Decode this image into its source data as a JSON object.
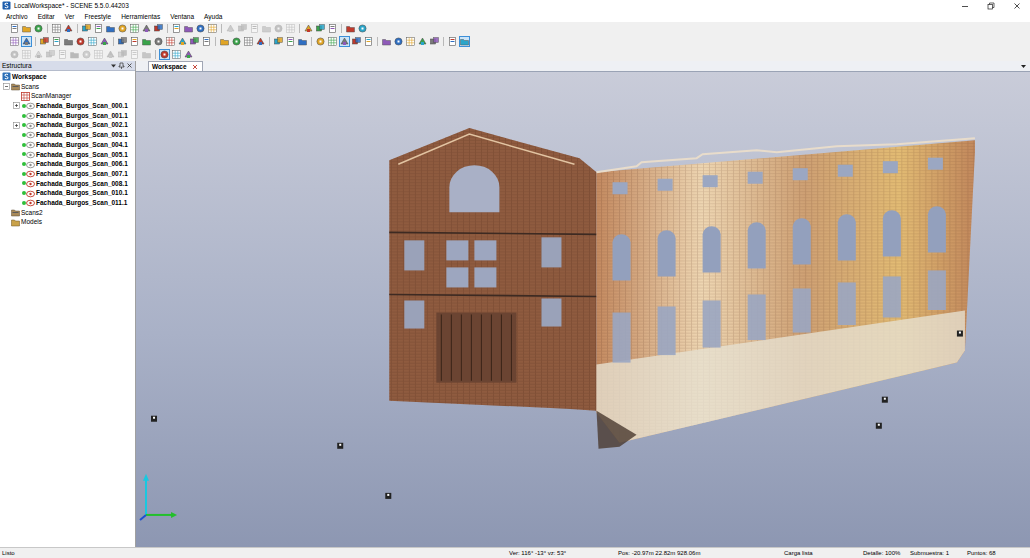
{
  "window": {
    "title": "LocalWorkspace* - SCENE 5.5.0.44203"
  },
  "menu": [
    {
      "label": "Archivo"
    },
    {
      "label": "Editar"
    },
    {
      "label": "Ver"
    },
    {
      "label": "Freestyle"
    },
    {
      "label": "Herramientas"
    },
    {
      "label": "Ventana"
    },
    {
      "label": "Ayuda"
    }
  ],
  "toolbars": [
    {
      "groups": [
        [
          {
            "selected": false,
            "disabled": false
          },
          {
            "selected": false,
            "disabled": false
          },
          {
            "selected": false,
            "disabled": false
          }
        ],
        [
          {
            "selected": false,
            "disabled": false
          },
          {
            "selected": false,
            "disabled": false
          }
        ],
        [
          {
            "selected": false,
            "disabled": false
          },
          {
            "selected": false,
            "disabled": false
          },
          {
            "selected": false,
            "disabled": false
          },
          {
            "selected": false,
            "disabled": false
          },
          {
            "selected": false,
            "disabled": false
          },
          {
            "selected": false,
            "disabled": false
          },
          {
            "selected": false,
            "disabled": false
          }
        ],
        [
          {
            "selected": false,
            "disabled": false
          },
          {
            "selected": false,
            "disabled": false
          },
          {
            "selected": false,
            "disabled": false
          },
          {
            "selected": false,
            "disabled": false
          }
        ],
        [
          {
            "selected": false,
            "disabled": true
          },
          {
            "selected": false,
            "disabled": true
          },
          {
            "selected": false,
            "disabled": true
          },
          {
            "selected": false,
            "disabled": true
          },
          {
            "selected": false,
            "disabled": true
          },
          {
            "selected": false,
            "disabled": true
          }
        ],
        [
          {
            "selected": false,
            "disabled": false
          },
          {
            "selected": false,
            "disabled": false
          },
          {
            "selected": false,
            "disabled": false
          }
        ],
        [
          {
            "selected": false,
            "disabled": false
          },
          {
            "selected": false,
            "disabled": false
          }
        ]
      ]
    },
    {
      "groups": [
        [
          {
            "selected": false,
            "disabled": false
          },
          {
            "selected": true,
            "disabled": false
          }
        ],
        [
          {
            "selected": false,
            "disabled": false
          },
          {
            "selected": false,
            "disabled": false
          },
          {
            "selected": false,
            "disabled": false
          },
          {
            "selected": false,
            "disabled": false
          },
          {
            "selected": false,
            "disabled": false
          },
          {
            "selected": false,
            "disabled": false
          }
        ],
        [
          {
            "selected": false,
            "disabled": false
          },
          {
            "selected": false,
            "disabled": false
          },
          {
            "selected": false,
            "disabled": false
          },
          {
            "selected": false,
            "disabled": false
          },
          {
            "selected": false,
            "disabled": false
          },
          {
            "selected": false,
            "disabled": false
          },
          {
            "selected": false,
            "disabled": false
          },
          {
            "selected": false,
            "disabled": false
          }
        ],
        [
          {
            "selected": false,
            "disabled": false
          },
          {
            "selected": false,
            "disabled": false
          },
          {
            "selected": false,
            "disabled": false
          },
          {
            "selected": false,
            "disabled": false
          }
        ],
        [
          {
            "selected": false,
            "disabled": false
          },
          {
            "selected": false,
            "disabled": false
          },
          {
            "selected": false,
            "disabled": false
          }
        ],
        [
          {
            "selected": false,
            "disabled": false
          },
          {
            "selected": false,
            "disabled": false
          },
          {
            "selected": true,
            "disabled": false
          },
          {
            "selected": false,
            "disabled": false
          },
          {
            "selected": false,
            "disabled": false
          }
        ],
        [
          {
            "selected": false,
            "disabled": false
          },
          {
            "selected": false,
            "disabled": false
          },
          {
            "selected": false,
            "disabled": false
          },
          {
            "selected": false,
            "disabled": false
          },
          {
            "selected": false,
            "disabled": false
          }
        ],
        [
          {
            "selected": false,
            "disabled": false
          },
          {
            "selected": true,
            "disabled": false
          }
        ]
      ]
    },
    {
      "groups": [
        [
          {
            "selected": false,
            "disabled": true
          },
          {
            "selected": false,
            "disabled": true
          },
          {
            "selected": false,
            "disabled": true
          },
          {
            "selected": false,
            "disabled": true
          },
          {
            "selected": false,
            "disabled": true
          },
          {
            "selected": false,
            "disabled": true
          },
          {
            "selected": false,
            "disabled": true
          },
          {
            "selected": false,
            "disabled": true
          },
          {
            "selected": false,
            "disabled": true
          },
          {
            "selected": false,
            "disabled": true
          },
          {
            "selected": false,
            "disabled": true
          },
          {
            "selected": false,
            "disabled": true
          }
        ],
        [
          {
            "selected": true,
            "disabled": false
          },
          {
            "selected": false,
            "disabled": false
          },
          {
            "selected": false,
            "disabled": false
          }
        ]
      ]
    }
  ],
  "structure_panel": {
    "title": "Estructura"
  },
  "tree": [
    {
      "label": "Workspace",
      "depth": 0,
      "kind": "workspace",
      "expandable": false,
      "expanded": false,
      "loaded": false,
      "color": "#2c6fb7"
    },
    {
      "label": "Scans",
      "depth": 1,
      "kind": "folder",
      "expandable": true,
      "expanded": true,
      "loaded": false,
      "color": "#a98a5a"
    },
    {
      "label": "ScanManager",
      "depth": 2,
      "kind": "manager",
      "expandable": false,
      "expanded": false,
      "loaded": false,
      "color": "#c0392b"
    },
    {
      "label": "Fachada_Burgos_Scan_000.1",
      "depth": 2,
      "kind": "scan",
      "expandable": true,
      "expanded": false,
      "loaded": true,
      "color": "#8c8c8c"
    },
    {
      "label": "Fachada_Burgos_Scan_001.1",
      "depth": 2,
      "kind": "scan",
      "expandable": false,
      "expanded": false,
      "loaded": true,
      "color": "#8c8c8c"
    },
    {
      "label": "Fachada_Burgos_Scan_002.1",
      "depth": 2,
      "kind": "scan",
      "expandable": true,
      "expanded": false,
      "loaded": true,
      "color": "#8c8c8c"
    },
    {
      "label": "Fachada_Burgos_Scan_003.1",
      "depth": 2,
      "kind": "scan",
      "expandable": false,
      "expanded": false,
      "loaded": true,
      "color": "#8c8c8c"
    },
    {
      "label": "Fachada_Burgos_Scan_004.1",
      "depth": 2,
      "kind": "scan",
      "expandable": false,
      "expanded": false,
      "loaded": true,
      "color": "#8c8c8c"
    },
    {
      "label": "Fachada_Burgos_Scan_005.1",
      "depth": 2,
      "kind": "scan",
      "expandable": false,
      "expanded": false,
      "loaded": true,
      "color": "#8c8c8c"
    },
    {
      "label": "Fachada_Burgos_Scan_006.1",
      "depth": 2,
      "kind": "scan",
      "expandable": false,
      "expanded": false,
      "loaded": true,
      "color": "#8c8c8c"
    },
    {
      "label": "Fachada_Burgos_Scan_007.1",
      "depth": 2,
      "kind": "scan",
      "expandable": false,
      "expanded": false,
      "loaded": true,
      "color": "#c0392b"
    },
    {
      "label": "Fachada_Burgos_Scan_008.1",
      "depth": 2,
      "kind": "scan",
      "expandable": false,
      "expanded": false,
      "loaded": true,
      "color": "#c0392b"
    },
    {
      "label": "Fachada_Burgos_Scan_010.1",
      "depth": 2,
      "kind": "scan",
      "expandable": false,
      "expanded": false,
      "loaded": true,
      "color": "#c0392b"
    },
    {
      "label": "Fachada_Burgos_Scan_011.1",
      "depth": 2,
      "kind": "scan",
      "expandable": false,
      "expanded": false,
      "loaded": true,
      "color": "#c0392b"
    },
    {
      "label": "Scans2",
      "depth": 1,
      "kind": "folder",
      "expandable": false,
      "expanded": false,
      "loaded": false,
      "color": "#a98a5a"
    },
    {
      "label": "Models",
      "depth": 1,
      "kind": "models",
      "expandable": false,
      "expanded": false,
      "loaded": false,
      "color": "#c9a24a"
    }
  ],
  "tabs": [
    {
      "label": "Workspace",
      "selected": true
    }
  ],
  "status_bar": [
    {
      "label": "Listo"
    },
    {
      "label": "Ver: 116° -13° vz: 53°"
    },
    {
      "label": "Pos: -20.97m 22.82m 928.06m"
    },
    {
      "label": "Carga lista"
    },
    {
      "label": "Detalle: 100%"
    },
    {
      "label": "Submuestra: 1"
    },
    {
      "label": "Puntos: 68"
    }
  ]
}
